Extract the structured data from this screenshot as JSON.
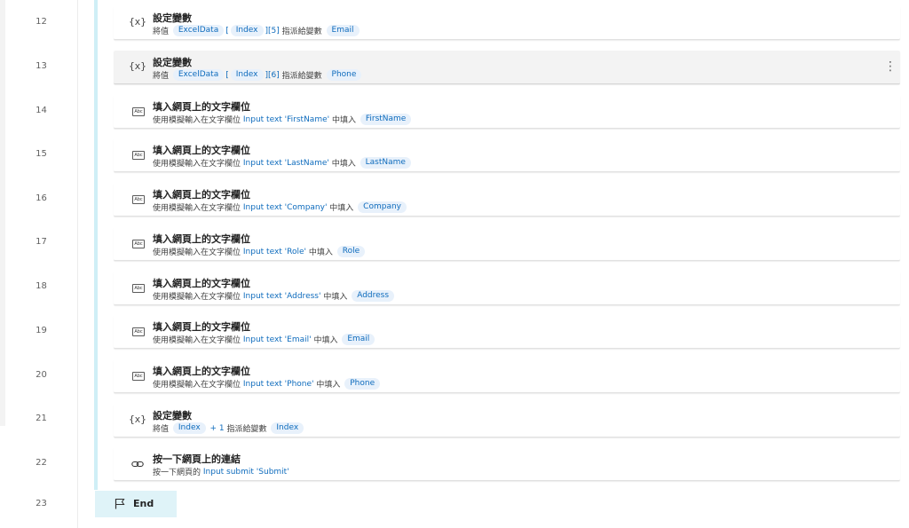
{
  "line_numbers": [
    "12",
    "13",
    "14",
    "15",
    "16",
    "17",
    "18",
    "19",
    "20",
    "21",
    "22",
    "23"
  ],
  "actions": [
    {
      "icon": "variable-icon",
      "title": "設定變數",
      "desc": [
        {
          "t": "text",
          "v": "將值 "
        },
        {
          "t": "tok",
          "v": "ExcelData"
        },
        {
          "t": "blue",
          "v": "["
        },
        {
          "t": "tok",
          "v": "Index"
        },
        {
          "t": "blue",
          "v": "][5]"
        },
        {
          "t": "text",
          "v": " 指派給變數 "
        },
        {
          "t": "tok",
          "v": "Email"
        }
      ]
    },
    {
      "icon": "variable-icon",
      "title": "設定變數",
      "selected": true,
      "desc": [
        {
          "t": "text",
          "v": "將值 "
        },
        {
          "t": "tok",
          "v": "ExcelData"
        },
        {
          "t": "blue",
          "v": "["
        },
        {
          "t": "tok",
          "v": "Index"
        },
        {
          "t": "blue",
          "v": "][6]"
        },
        {
          "t": "text",
          "v": " 指派給變數 "
        },
        {
          "t": "tok",
          "v": "Phone"
        }
      ]
    },
    {
      "icon": "textfield-icon",
      "title": "填入網頁上的文字欄位",
      "desc": [
        {
          "t": "text",
          "v": "使用模擬輸入在文字欄位 "
        },
        {
          "t": "blue",
          "v": "Input text 'FirstName'"
        },
        {
          "t": "text",
          "v": " 中填入 "
        },
        {
          "t": "tok",
          "v": "FirstName"
        }
      ]
    },
    {
      "icon": "textfield-icon",
      "title": "填入網頁上的文字欄位",
      "desc": [
        {
          "t": "text",
          "v": "使用模擬輸入在文字欄位 "
        },
        {
          "t": "blue",
          "v": "Input text 'LastName'"
        },
        {
          "t": "text",
          "v": " 中填入 "
        },
        {
          "t": "tok",
          "v": "LastName"
        }
      ]
    },
    {
      "icon": "textfield-icon",
      "title": "填入網頁上的文字欄位",
      "desc": [
        {
          "t": "text",
          "v": "使用模擬輸入在文字欄位 "
        },
        {
          "t": "blue",
          "v": "Input text 'Company'"
        },
        {
          "t": "text",
          "v": " 中填入 "
        },
        {
          "t": "tok",
          "v": "Company"
        }
      ]
    },
    {
      "icon": "textfield-icon",
      "title": "填入網頁上的文字欄位",
      "desc": [
        {
          "t": "text",
          "v": "使用模擬輸入在文字欄位 "
        },
        {
          "t": "blue",
          "v": "Input text 'Role'"
        },
        {
          "t": "text",
          "v": " 中填入 "
        },
        {
          "t": "tok",
          "v": "Role"
        }
      ]
    },
    {
      "icon": "textfield-icon",
      "title": "填入網頁上的文字欄位",
      "desc": [
        {
          "t": "text",
          "v": "使用模擬輸入在文字欄位 "
        },
        {
          "t": "blue",
          "v": "Input text 'Address'"
        },
        {
          "t": "text",
          "v": " 中填入 "
        },
        {
          "t": "tok",
          "v": "Address"
        }
      ]
    },
    {
      "icon": "textfield-icon",
      "title": "填入網頁上的文字欄位",
      "desc": [
        {
          "t": "text",
          "v": "使用模擬輸入在文字欄位 "
        },
        {
          "t": "blue",
          "v": "Input text 'Email'"
        },
        {
          "t": "text",
          "v": " 中填入 "
        },
        {
          "t": "tok",
          "v": "Email"
        }
      ]
    },
    {
      "icon": "textfield-icon",
      "title": "填入網頁上的文字欄位",
      "desc": [
        {
          "t": "text",
          "v": "使用模擬輸入在文字欄位 "
        },
        {
          "t": "blue",
          "v": "Input text 'Phone'"
        },
        {
          "t": "text",
          "v": " 中填入 "
        },
        {
          "t": "tok",
          "v": "Phone"
        }
      ]
    },
    {
      "icon": "variable-icon",
      "title": "設定變數",
      "desc": [
        {
          "t": "text",
          "v": "將值 "
        },
        {
          "t": "tok",
          "v": "Index"
        },
        {
          "t": "blue",
          "v": " + 1"
        },
        {
          "t": "text",
          "v": " 指派給變數 "
        },
        {
          "t": "tok",
          "v": "Index"
        }
      ]
    },
    {
      "icon": "link-icon",
      "title": "按一下網頁上的連結",
      "desc": [
        {
          "t": "text",
          "v": "按一下網頁的 "
        },
        {
          "t": "blue",
          "v": "Input submit 'Submit'"
        }
      ]
    }
  ],
  "end": {
    "label": "End"
  },
  "icons": {
    "variable": "{x}",
    "textfield": "Abc",
    "more": "⋮"
  },
  "colors": {
    "accent": "#0f6cbd",
    "token_bg": "#e8f1fb",
    "loop_bar": "#cfeff6",
    "selected_bg": "#f3f3f3"
  }
}
